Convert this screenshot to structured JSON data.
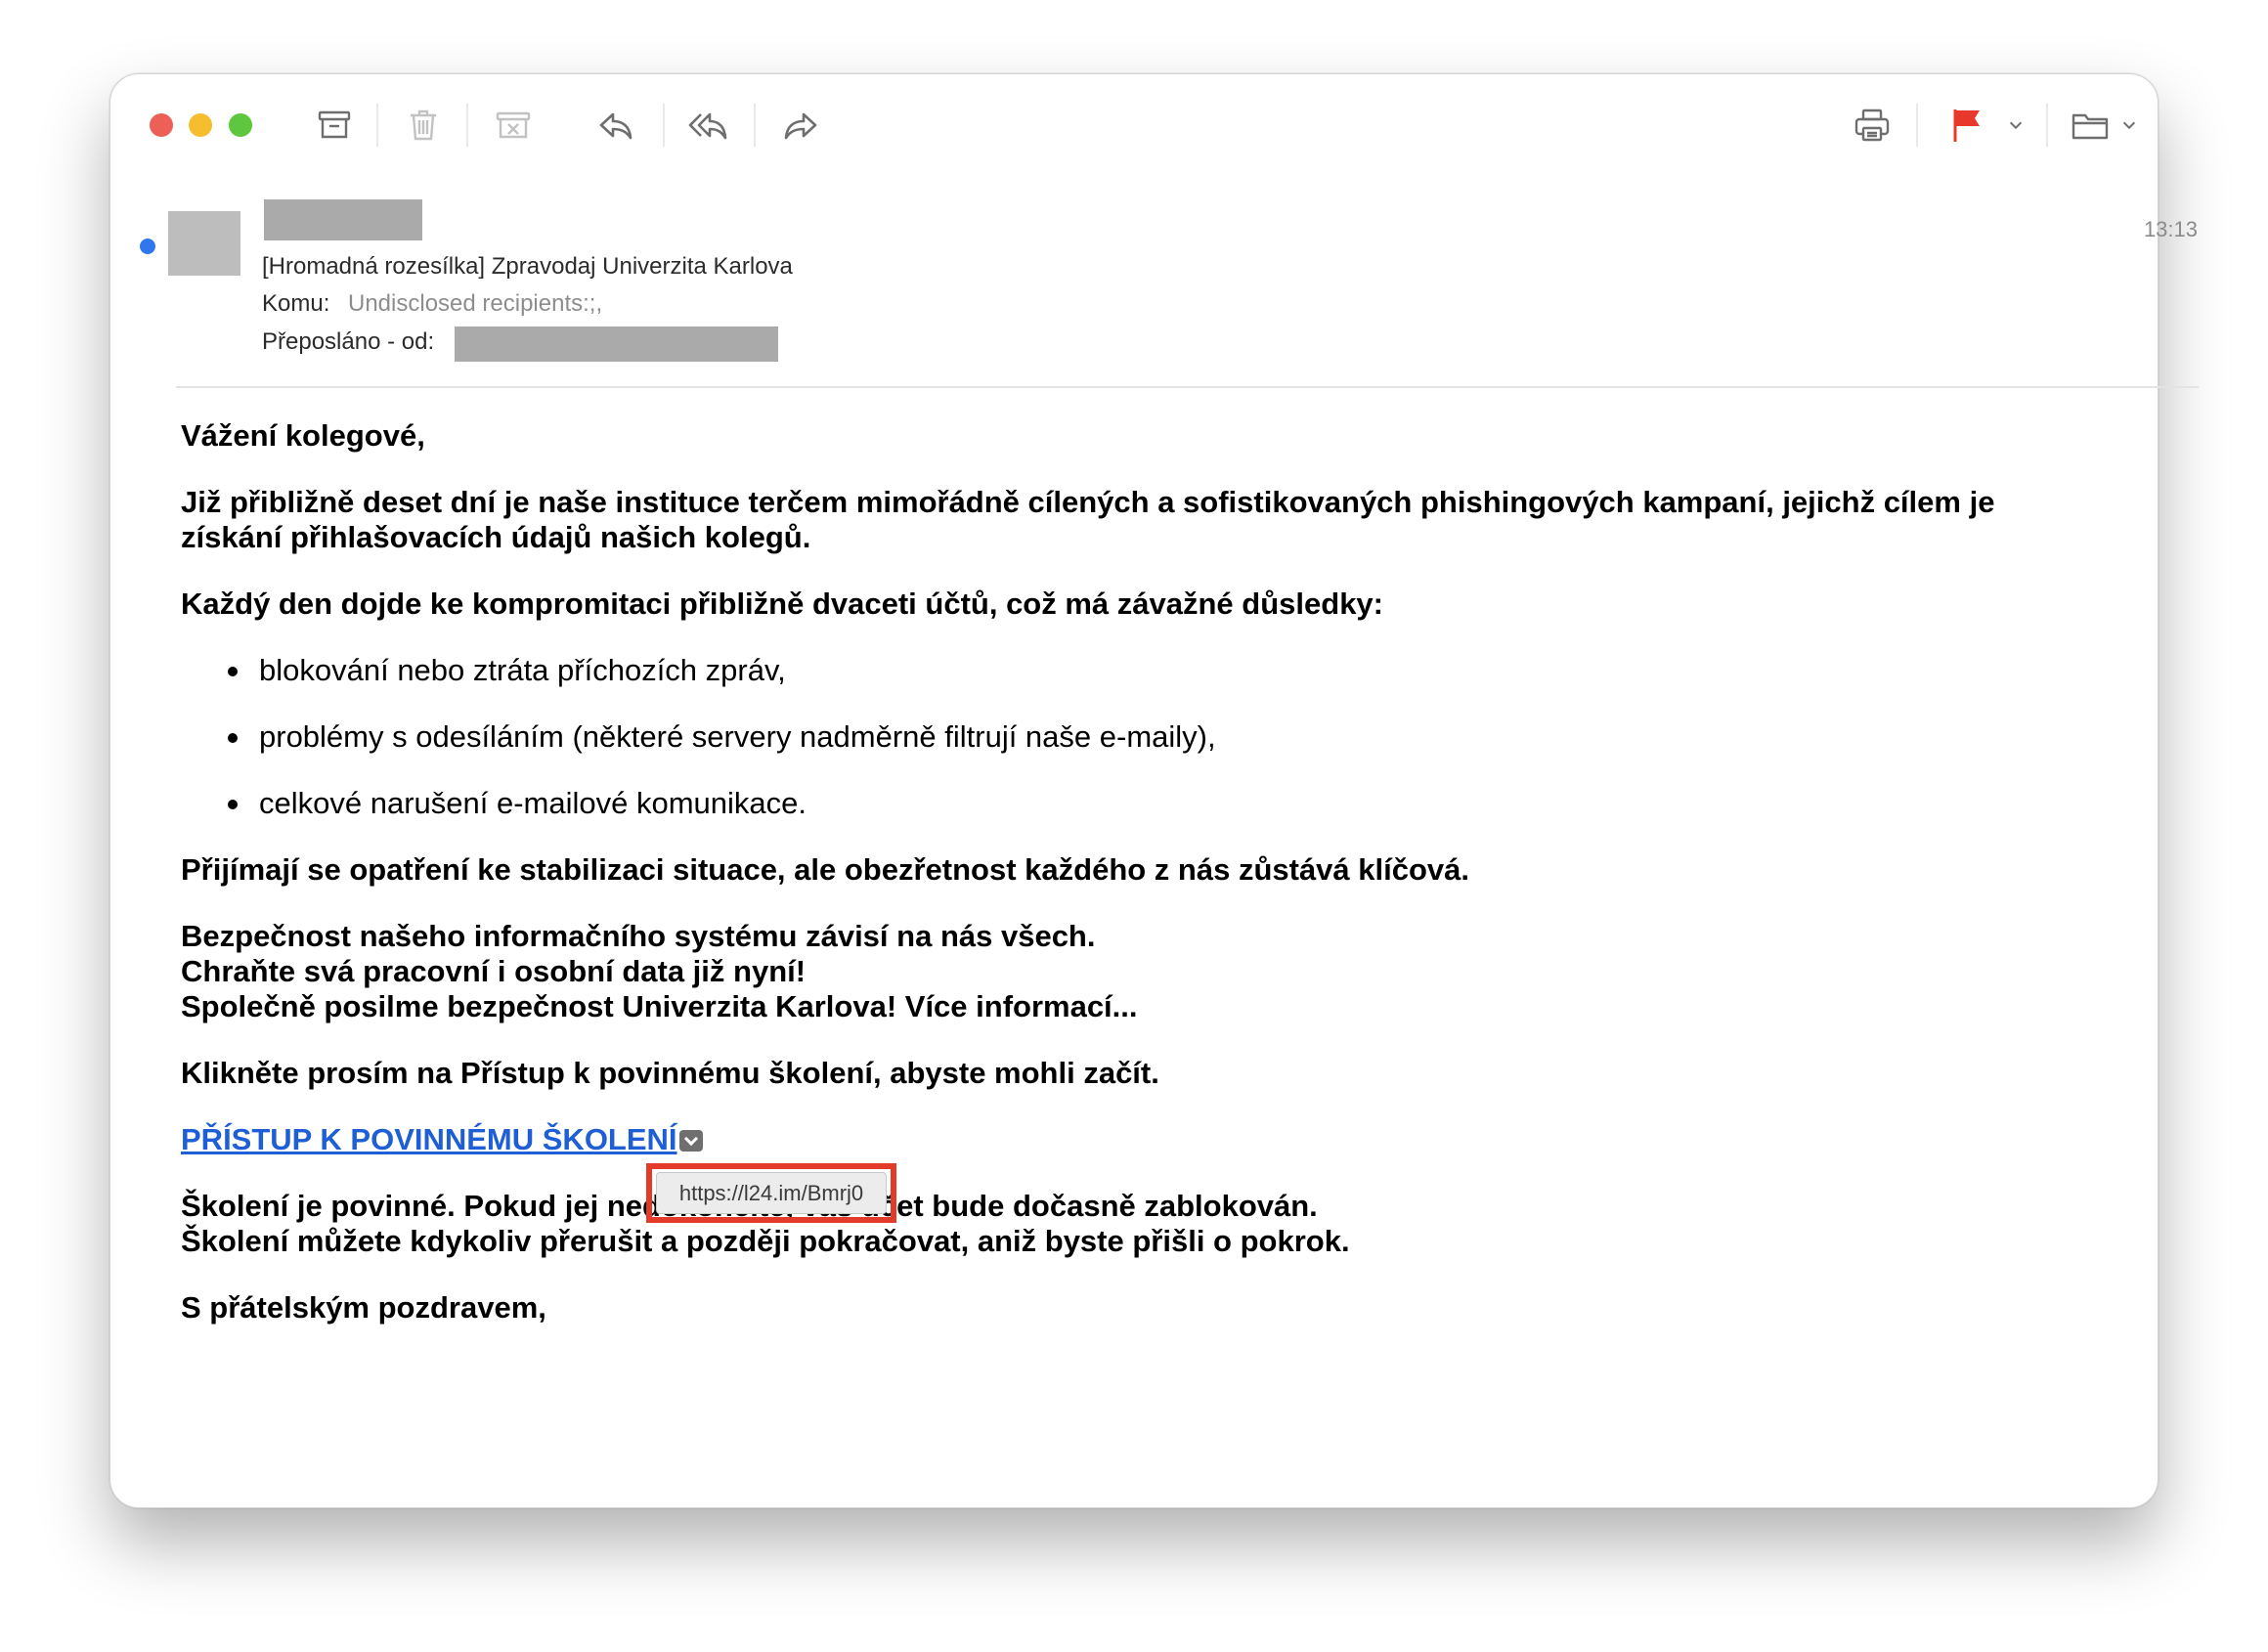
{
  "window": {
    "traffic_lights": {
      "close": "#ee5f57",
      "minimize": "#f5be2f",
      "zoom": "#5fc640"
    }
  },
  "toolbar": {
    "left_icons": [
      "archive-icon",
      "trash-icon",
      "junk-icon",
      "reply-icon",
      "reply-all-icon",
      "forward-icon"
    ],
    "right_icons": [
      "print-icon",
      "flag-icon",
      "flag-menu-chevron-icon",
      "move-folder-icon",
      "folder-menu-chevron-icon"
    ],
    "flag_color": "#e8382b"
  },
  "message": {
    "subject": "[Hromadná rozesílka] Zpravodaj Univerzita Karlova",
    "to_label": "Komu:",
    "to_value": "Undisclosed recipients:;,",
    "forwarded_label": "Přeposláno - od:",
    "time": "13:13",
    "accent": "#2f76ef"
  },
  "body": {
    "greeting": "Vážení kolegové,",
    "para1": "Již přibližně deset dní je naše instituce terčem mimořádně cílených a sofistikovaných phishingových kampaní, jejichž cílem je získání přihlašovacích údajů našich kolegů.",
    "para2": "Každý den dojde ke kompromitaci přibližně dvaceti účtů, což má závažné důsledky:",
    "bullets": [
      "blokování nebo ztráta příchozích zpráv,",
      "problémy s odesíláním (některé servery nadměrně filtrují naše e-maily),",
      "celkové narušení e-mailové komunikace."
    ],
    "para3": "Přijímají se opatření ke stabilizaci situace, ale obezřetnost každého z nás zůstává klíčová.",
    "para4_line1": "Bezpečnost našeho informačního systému závisí na nás všech.",
    "para4_line2": "Chraňte svá pracovní i osobní data již nyní!",
    "para4_line3": "Společně posilme bezpečnost Univerzita Karlova! Více informací...",
    "para5": "Klikněte prosím na Přístup k povinnému školení, abyste mohli začít.",
    "link_label": "PŘÍSTUP K POVINNÉMU ŠKOLENÍ",
    "para6_line1": "Školení je povinné. Pokud jej nedokončíte, váš účet bude dočasně zablokován.",
    "para6_line2": "Školení můžete kdykoliv přerušit a později pokračovat, aniž byste přišli o pokrok.",
    "closing": "S přátelským pozdravem,"
  },
  "tooltip": {
    "url": "https://l24.im/Bmrj0",
    "highlight_color": "#e23b2a"
  }
}
